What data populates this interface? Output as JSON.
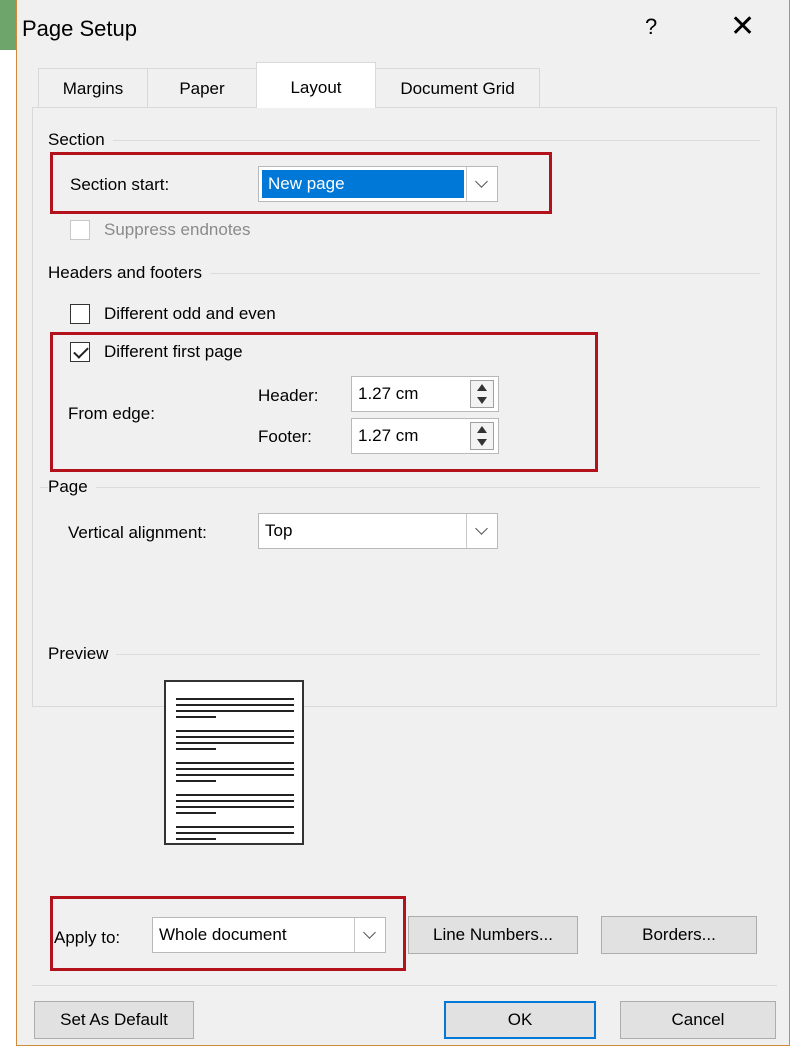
{
  "title": "Page Setup",
  "help_label": "?",
  "close_glyph": "✕",
  "tabs": [
    {
      "label": "Margins"
    },
    {
      "label": "Paper"
    },
    {
      "label": "Layout"
    },
    {
      "label": "Document Grid"
    }
  ],
  "active_tab": "Layout",
  "section": {
    "group": "Section",
    "start_label": "Section start:",
    "start_value": "New page",
    "suppress_endnotes": "Suppress endnotes"
  },
  "headers_footers": {
    "group": "Headers and footers",
    "odd_even_label": "Different odd and even",
    "odd_even_checked": false,
    "first_page_label": "Different first page",
    "first_page_checked": true,
    "from_edge_label": "From edge:",
    "header_label": "Header:",
    "header_value": "1.27 cm",
    "footer_label": "Footer:",
    "footer_value": "1.27 cm"
  },
  "page": {
    "group": "Page",
    "vertical_alignment_label": "Vertical alignment:",
    "vertical_alignment_value": "Top"
  },
  "preview": {
    "group": "Preview"
  },
  "apply": {
    "label": "Apply to:",
    "value": "Whole document",
    "line_numbers": "Line Numbers...",
    "borders": "Borders..."
  },
  "footer_buttons": {
    "set_default": "Set As Default",
    "ok": "OK",
    "cancel": "Cancel"
  },
  "colors": {
    "highlight": "#b3121c",
    "selection": "#0078d7"
  }
}
